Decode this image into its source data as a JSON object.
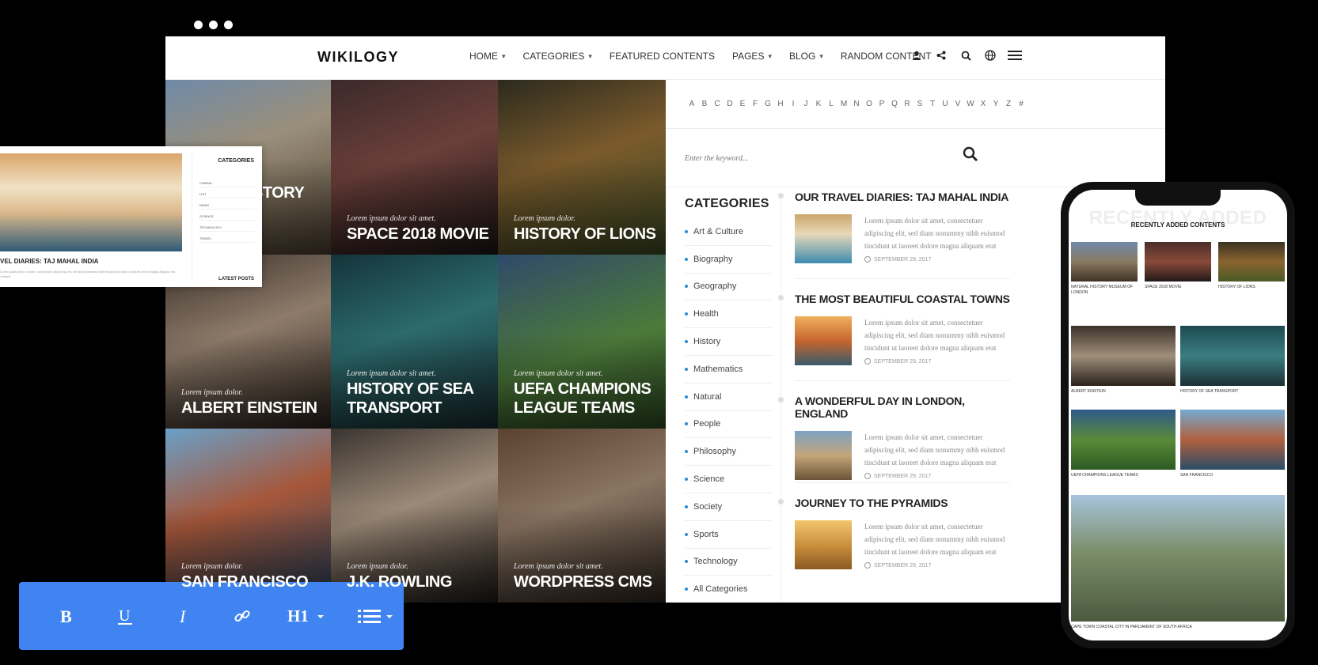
{
  "brand": {
    "logo": "WIKILOGY"
  },
  "nav": [
    {
      "label": "HOME",
      "dropdown": true
    },
    {
      "label": "CATEGORIES",
      "dropdown": true
    },
    {
      "label": "FEATURED CONTENTS",
      "dropdown": false
    },
    {
      "label": "PAGES",
      "dropdown": true
    },
    {
      "label": "BLOG",
      "dropdown": true
    },
    {
      "label": "RANDOM CONTENT",
      "dropdown": false
    }
  ],
  "header_icons": [
    "user-icon",
    "share-icon",
    "search-icon",
    "globe-icon",
    "menu-icon"
  ],
  "tiles": [
    {
      "subtitle": "",
      "title": "STORY"
    },
    {
      "subtitle": "Lorem ipsum dolor sit amet.",
      "title": "SPACE 2018 MOVIE"
    },
    {
      "subtitle": "Lorem ipsum dolor.",
      "title": "HISTORY OF LIONS"
    },
    {
      "subtitle": "Lorem ipsum dolor.",
      "title": "ALBERT EINSTEIN"
    },
    {
      "subtitle": "Lorem ipsum dolor sit amet.",
      "title": "HISTORY OF SEA TRANSPORT"
    },
    {
      "subtitle": "Lorem ipsum dolor sit amet.",
      "title": "UEFA CHAMPIONS LEAGUE TEAMS"
    },
    {
      "subtitle": "Lorem ipsum dolor.",
      "title": "SAN FRANCISCO"
    },
    {
      "subtitle": "Lorem ipsum dolor.",
      "title": "J.K. ROWLING"
    },
    {
      "subtitle": "Lorem ipsum dolor sit amet.",
      "title": "WORDPRESS CMS"
    }
  ],
  "alphabet": [
    "A",
    "B",
    "C",
    "D",
    "E",
    "F",
    "G",
    "H",
    "I",
    "J",
    "K",
    "L",
    "M",
    "N",
    "O",
    "P",
    "Q",
    "R",
    "S",
    "T",
    "U",
    "V",
    "W",
    "X",
    "Y",
    "Z",
    "#"
  ],
  "search": {
    "placeholder": "Enter the keyword..."
  },
  "categories": {
    "title": "CATEGORIES",
    "items": [
      "Art & Culture",
      "Biography",
      "Geography",
      "Health",
      "History",
      "Mathematics",
      "Natural",
      "People",
      "Philosophy",
      "Science",
      "Society",
      "Sports",
      "Technology",
      "All Categories"
    ]
  },
  "posts": [
    {
      "title": "OUR TRAVEL DIARIES: TAJ MAHAL INDIA",
      "text": "Lorem ipsum dolor sit amet, consectetuer adipiscing elit, sed diam nonummy nibh euismod tincidunt ut laoreet dolore magna aliquam erat",
      "date": "SEPTEMBER 29, 2017"
    },
    {
      "title": "THE MOST BEAUTIFUL COASTAL TOWNS",
      "text": "Lorem ipsum dolor sit amet, consectetuer adipiscing elit, sed diam nonummy nibh euismod tincidunt ut laoreet dolore magna aliquam erat",
      "date": "SEPTEMBER 29, 2017"
    },
    {
      "title": "A WONDERFUL DAY IN LONDON, ENGLAND",
      "text": "Lorem ipsum dolor sit amet, consectetuer adipiscing elit, sed diam nonummy nibh euismod tincidunt ut laoreet dolore magna aliquam erat",
      "date": "SEPTEMBER 29, 2017"
    },
    {
      "title": "JOURNEY TO THE PYRAMIDS",
      "text": "Lorem ipsum dolor sit amet, consectetuer adipiscing elit, sed diam nonummy nibh euismod tincidunt ut laoreet dolore magna aliquam erat",
      "date": "SEPTEMBER 29, 2017"
    }
  ],
  "card": {
    "title": "VEL DIARIES: TAJ MAHAL INDIA",
    "text": "Lorem ipsum dolor sit amet, consectetuer adipiscing elit, sed diam nonummy nibh euismod tincidunt ut laoreet dolore magna aliquam erat volutpat.",
    "categories_title": "CATEGORIES",
    "categories": [
      "CINEMA",
      "LIST",
      "NEWS",
      "SCIENCE",
      "TECHNOLOGY",
      "TRAVEL"
    ],
    "latest_title": "LATEST POSTS"
  },
  "toolbar": {
    "buttons": [
      "bold",
      "underline",
      "italic",
      "link",
      "heading-1",
      "list"
    ]
  },
  "phone": {
    "ghost_title": "RECENTLY ADDED",
    "title": "RECENTLY ADDED CONTENTS",
    "items": [
      "NATURAL HISTORY MUSEUM OF LONDON",
      "SPACE 2018 MOVIE",
      "HISTORY OF LIONS",
      "ALBERT EINSTEIN",
      "HISTORY OF SEA TRANSPORT",
      "UEFA CHAMPIONS LEAGUE TEAMS",
      "SAN FRANCISCO",
      "CAPE TOWN COASTAL CITY IN PARLIAMENT OF SOUTH AFRICA"
    ]
  }
}
